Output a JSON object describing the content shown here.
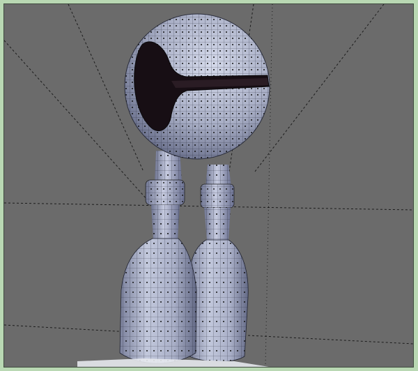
{
  "window": {
    "background_color": "#6b6b6b",
    "frame_color": "#b9d8b3"
  },
  "viewport": {
    "mode": "wireframe-mesh",
    "subject": "robot-model",
    "guides": "camera-lines-dashed"
  },
  "colors": {
    "mesh_fill": "#b8bed4",
    "mesh_shadow": "#6f7591",
    "mesh_wire": "#1f2230",
    "cavity": "#170e14",
    "guide": "#1c1c1c"
  }
}
